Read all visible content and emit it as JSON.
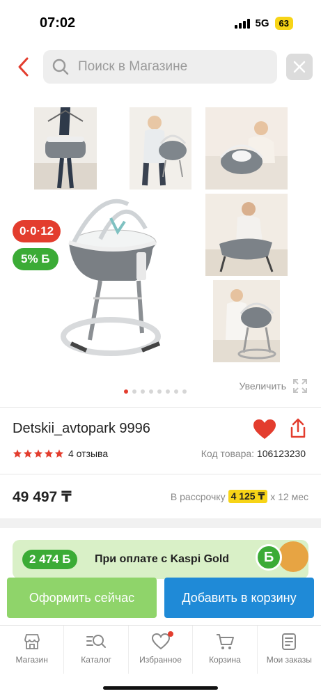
{
  "status_bar": {
    "time": "07:02",
    "network": "5G",
    "battery": "63"
  },
  "search": {
    "placeholder": "Поиск в Магазине"
  },
  "gallery": {
    "date_badge": "0·0·12",
    "bonus_badge": "5% Б",
    "zoom_label": "Увеличить",
    "dots_count": 8,
    "active_dot": 0
  },
  "product": {
    "title": "Detskii_avtopark 9996",
    "rating": 5,
    "reviews": "4 отзыва",
    "sku_label": "Код товара:",
    "sku_value": "106123230",
    "price": "49 497 ₸",
    "installment_prefix": "В рассрочку",
    "installment_amount": "4 125 ₸",
    "installment_suffix": "х 12 мес"
  },
  "kaspi": {
    "amount": "2 474 Б",
    "text": "При оплате с Kaspi Gold",
    "icon_letter": "Б"
  },
  "actions": {
    "buy_now": "Оформить сейчас",
    "add_to_cart": "Добавить в корзину"
  },
  "tabs": [
    {
      "label": "Магазин",
      "icon": "shop-icon"
    },
    {
      "label": "Каталог",
      "icon": "catalog-search-icon"
    },
    {
      "label": "Избранное",
      "icon": "heart-icon",
      "has_dot": true
    },
    {
      "label": "Корзина",
      "icon": "cart-icon"
    },
    {
      "label": "Мои заказы",
      "icon": "orders-icon"
    }
  ],
  "colors": {
    "accent_red": "#e33d2e",
    "green": "#3bab36",
    "blue": "#1f8ad7",
    "yellow": "#f7d417"
  }
}
